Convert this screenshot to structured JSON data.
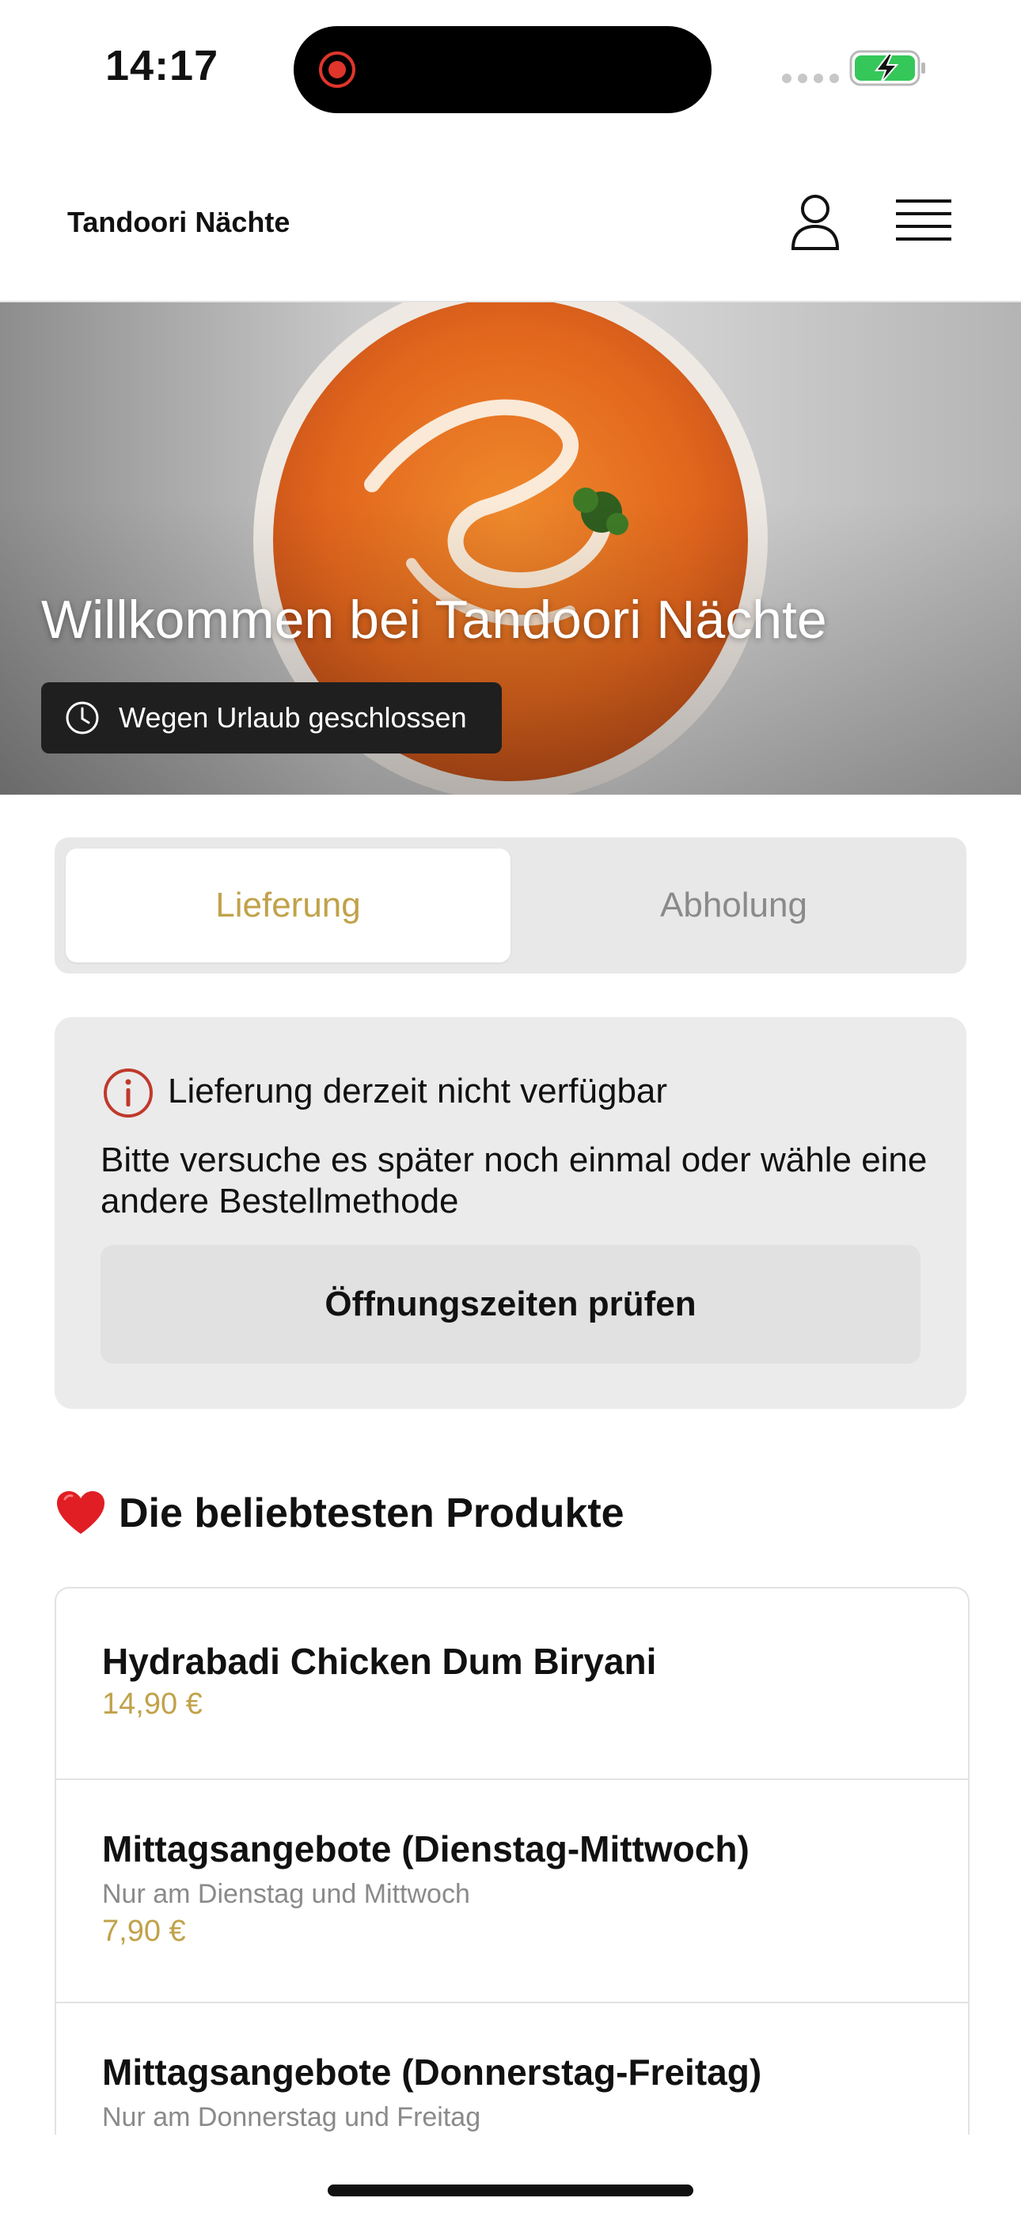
{
  "status_bar": {
    "time": "14:17",
    "colors": {
      "recording": "#e0352b",
      "battery": "#35c759"
    }
  },
  "header": {
    "brand": "Tandoori Nächte",
    "icons": [
      "profile-icon",
      "menu-icon"
    ]
  },
  "hero": {
    "title": "Willkommen bei Tandoori Nächte",
    "closed_badge": "Wegen Urlaub geschlossen"
  },
  "order_mode": {
    "options": [
      "Lieferung",
      "Abholung"
    ],
    "selected": "Lieferung"
  },
  "notice": {
    "title": "Lieferung derzeit nicht verfügbar",
    "text": "Bitte versuche es später noch einmal oder wähle eine andere Bestellmethode",
    "button": "Öffnungszeiten prüfen"
  },
  "popular": {
    "title": "Die beliebtesten Produkte",
    "products": [
      {
        "name": "Hydrabadi Chicken Dum Biryani",
        "note": "",
        "price": "14,90 €"
      },
      {
        "name": "Mittagsangebote (Dienstag-Mittwoch)",
        "note": "Nur am Dienstag und Mittwoch",
        "price": "7,90 €"
      },
      {
        "name": "Mittagsangebote (Donnerstag-Freitag)",
        "note": "Nur am Donnerstag und Freitag",
        "price": ""
      }
    ]
  },
  "theme": {
    "accent": "#c1a24a"
  }
}
